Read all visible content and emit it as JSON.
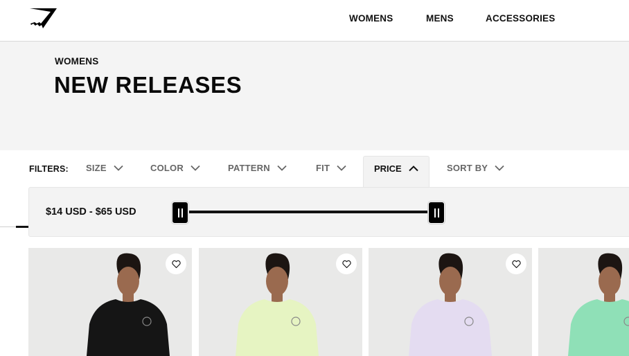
{
  "header": {
    "logo_icon": "gymshark-logo-icon",
    "nav": [
      {
        "label": "WOMENS"
      },
      {
        "label": "MENS"
      },
      {
        "label": "ACCESSORIES"
      }
    ]
  },
  "hero": {
    "breadcrumb": "WOMENS",
    "title": "NEW RELEASES"
  },
  "filters": {
    "label": "FILTERS:",
    "items": [
      {
        "label": "SIZE",
        "icon": "chevron-down-icon",
        "expanded": false
      },
      {
        "label": "COLOR",
        "icon": "chevron-down-icon",
        "expanded": false
      },
      {
        "label": "PATTERN",
        "icon": "chevron-down-icon",
        "expanded": false
      },
      {
        "label": "FIT",
        "icon": "chevron-down-icon",
        "expanded": false
      },
      {
        "label": "PRICE",
        "icon": "chevron-up-icon",
        "expanded": true
      },
      {
        "label": "SORT BY",
        "icon": "chevron-down-icon",
        "expanded": false
      }
    ]
  },
  "price_filter": {
    "range_text": "$14 USD - $65 USD",
    "min": 14,
    "max": 65,
    "selected_min": 14,
    "selected_max": 65,
    "currency": "USD"
  },
  "products": [
    {
      "shirt_color": "#151515",
      "wishlist_icon": "heart-outline-icon",
      "description": "Model in black t-shirt"
    },
    {
      "shirt_color": "#e6f4c2",
      "wishlist_icon": "heart-outline-icon",
      "description": "Model in light lime t-shirt"
    },
    {
      "shirt_color": "#e4dcf1",
      "wishlist_icon": "heart-outline-icon",
      "description": "Model in lilac t-shirt"
    },
    {
      "shirt_color": "#8fe0b7",
      "wishlist_icon": "heart-outline-icon",
      "description": "Model in mint green t-shirt"
    }
  ],
  "colors": {
    "hero_bg": "#f4f4f4",
    "panel_bg": "#f3f3f3",
    "filter_inactive": "#666666",
    "text": "#111111",
    "photo_bg": "#e9e9e8",
    "skin": "#9a6a4f",
    "hair": "#1c1512"
  }
}
